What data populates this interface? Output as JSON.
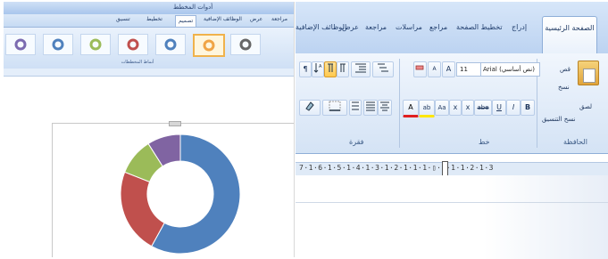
{
  "left_window": {
    "title": "أدوات المخطط",
    "tabs": [
      "مراجعة",
      "عرض",
      "الوظائف الإضافية",
      "تصميم",
      "تخطيط",
      "تنسيق"
    ],
    "active_tab": "تصميم",
    "ribbon_group": "أنماط المخططات",
    "ring_styles": [
      {
        "color": "#7b6bb0"
      },
      {
        "color": "#4f81bd"
      },
      {
        "color": "#9bbb59"
      },
      {
        "color": "#c0504d"
      },
      {
        "color": "#4f81bd"
      },
      {
        "color": "#f0a445"
      },
      {
        "color": "#666666"
      }
    ]
  },
  "chart_data": {
    "type": "pie",
    "variant": "doughnut",
    "slices": [
      {
        "value": 58,
        "color": "#4f81bd"
      },
      {
        "value": 23,
        "color": "#c0504d"
      },
      {
        "value": 10,
        "color": "#9bbb59"
      },
      {
        "value": 9,
        "color": "#8064a2"
      }
    ],
    "title": "",
    "legend": "none"
  },
  "right_window": {
    "tabs": {
      "home": "الصفحة الرئيسية",
      "insert": "إدراج",
      "page_layout": "تخطيط الصفحة",
      "references": "مراجع",
      "mailings": "مراسلات",
      "review": "مراجعة",
      "view": "عرض",
      "addins": "الوظائف الإضافية"
    },
    "clipboard": {
      "paste": "لصق",
      "cut": "قص",
      "copy": "نسخ",
      "format_painter": "نسخ التنسيق",
      "group_label": "الحافظة"
    },
    "font": {
      "font_name": "Arial (نص أساسي)",
      "font_size": "11",
      "grow": "A",
      "shrink": "A",
      "clear_format": "Aa",
      "bold": "B",
      "italic": "I",
      "underline": "U",
      "strike": "abe",
      "subscript": "x",
      "superscript": "x",
      "change_case": "Aa",
      "highlight": "ab",
      "font_color": "A",
      "group_label": "خط"
    },
    "paragraph": {
      "group_label": "فقرة",
      "pilcrow": "¶"
    },
    "ruler_numbers": "7·1·6·1·5·1·4·1·3·1·2·1·1·1·▯·1·1·1·2·1·3"
  }
}
